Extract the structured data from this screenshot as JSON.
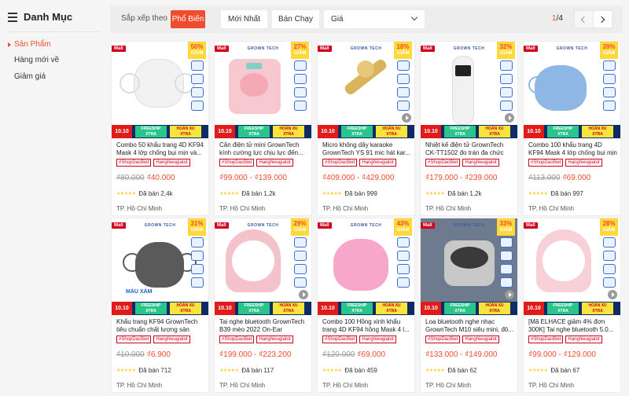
{
  "sidebar": {
    "title": "Danh Mục",
    "items": [
      {
        "label": "Sản Phẩm"
      },
      {
        "label": "Hàng mới về"
      },
      {
        "label": "Giảm giá"
      }
    ]
  },
  "sortbar": {
    "label": "Sắp xếp theo",
    "options": [
      {
        "label": "Phổ Biến"
      },
      {
        "label": "Mới Nhất"
      },
      {
        "label": "Bán Chạy"
      }
    ],
    "price_select": "Giá",
    "page_current": "1",
    "page_total": "/4"
  },
  "promo": {
    "d10": "10.10",
    "freeship_1": "FREESHIP",
    "freeship_2": "XTRA",
    "hoan_1": "HOÀN XU",
    "hoan_2": "XTRA"
  },
  "discount_label": "GIẢM",
  "mall_label": "Mall",
  "colors": {
    "accent": "#ee4d2d",
    "mall": "#d0011b",
    "discount_bg": "#ffd839",
    "promo_bg": "#0e2b65",
    "freeship": "#2ac58a"
  },
  "products": [
    {
      "discount": "50%",
      "name": "Combo 50 khẩu trang 4D KF94 Mask 4 lớp chống bụi mịn và...",
      "tags": [
        "#ShopDacBiet",
        "Hanghieugiatot"
      ],
      "old_price": "₫80.000",
      "price": "₫40.000",
      "sold": "Đã bán 2,4k",
      "location": "TP. Hồ Chí Minh",
      "brand": "",
      "video": false
    },
    {
      "discount": "27%",
      "name": "Cân điện tử mini GrownTech kính cường lực chịu lực đến...",
      "tags": [
        "#ShopDacBiet",
        "Hanghieugiatot"
      ],
      "old_price": "",
      "price": "₫99.000 - ₫139.000",
      "sold": "Đã bán 1,2k",
      "location": "TP. Hồ Chí Minh",
      "brand": "GROWN TECH",
      "video": false
    },
    {
      "discount": "18%",
      "name": "Micro không dây karaoke GrownTech YS 91 mic hát kar...",
      "tags": [
        "#ShopDacBiet",
        "Hanghieugiatot"
      ],
      "old_price": "",
      "price": "₫409.000 - ₫429.000",
      "sold": "Đã bán 999",
      "location": "TP. Hồ Chí Minh",
      "brand": "GROWN TECH",
      "video": true
    },
    {
      "discount": "32%",
      "name": "Nhiệt kế điện tử GrownTech CK-TT1502 đo trán đa chức năng...",
      "tags": [
        "#ShopDacBiet",
        "Hanghieugiatot"
      ],
      "old_price": "",
      "price": "₫179.000 - ₫239.000",
      "sold": "Đã bán 1,2k",
      "location": "TP. Hồ Chí Minh",
      "brand": "GROWN TECH",
      "video": true
    },
    {
      "discount": "39%",
      "name": "Combo 100 khẩu trang 4D KF94 Mask 4 lớp chống bụi mịn và...",
      "tags": [
        "#ShopDacBiet",
        "Hanghieugiatot"
      ],
      "old_price": "₫113.000",
      "price": "₫69.000",
      "sold": "Đã bán 997",
      "location": "TP. Hồ Chí Minh",
      "brand": "GROWN TECH",
      "video": false
    },
    {
      "discount": "31%",
      "name": "Khẩu trang KF94 GrownTech tiêu chuẩn chất lượng sản xuất...",
      "tags": [
        "#ShopDacBiet",
        "Hanghieugiatot"
      ],
      "old_price": "₫10.000",
      "price": "₫6.900",
      "sold": "Đã bán 712",
      "location": "TP. Hồ Chí Minh",
      "brand": "GROWN TECH",
      "caption": "MÀU XÁM",
      "video": false
    },
    {
      "discount": "29%",
      "name": "Tai nghe bluetooth GrownTech B39 mèo 2022 On-Ear bluetoo...",
      "tags": [
        "#ShopDacBiet",
        "Hanghieugiatot"
      ],
      "old_price": "",
      "price": "₫199.000 - ₫223.200",
      "sold": "Đã bán 117",
      "location": "TP. Hồ Chí Minh",
      "brand": "GROWN TECH",
      "video": true
    },
    {
      "discount": "43%",
      "name": "Combo 100 Hồng xinh khẩu trang 4D KF94 hồng Mask 4 l...",
      "tags": [
        "#ShopDacBiet",
        "Hanghieugiatot"
      ],
      "old_price": "₫120.000",
      "price": "₫69.000",
      "sold": "Đã bán 459",
      "location": "TP. Hồ Chí Minh",
      "brand": "GROWN TECH",
      "video": false
    },
    {
      "discount": "33%",
      "name": "Loa bluetooth nghe nhạc GrownTech M10 siêu mini, đô...",
      "tags": [
        "#ShopDacBiet",
        "Hanghieugiatot"
      ],
      "old_price": "",
      "price": "₫133.000 - ₫149.000",
      "sold": "Đã bán 62",
      "location": "TP. Hồ Chí Minh",
      "brand": "GROWN TECH",
      "video": true
    },
    {
      "discount": "28%",
      "name": "[Mã ELHACE giảm 4% đơn 300K] Tai nghe bluetooth 5.0...",
      "tags": [
        "#ShopDacBiet",
        "Hanghieugiatot"
      ],
      "old_price": "",
      "price": "₫99.000 - ₫129.000",
      "sold": "Đã bán 67",
      "location": "TP. Hồ Chí Minh",
      "brand": "",
      "video": true
    }
  ]
}
